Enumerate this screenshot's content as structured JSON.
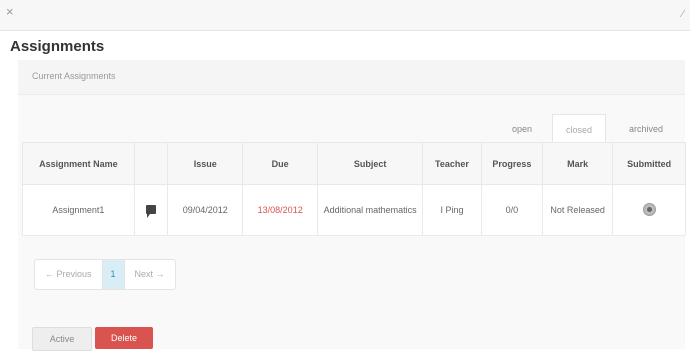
{
  "window": {
    "close_glyph": "×",
    "resize_glyph": "⁄"
  },
  "page": {
    "title": "Assignments"
  },
  "panel": {
    "heading": "Current Assignments"
  },
  "filters": {
    "open": "open",
    "closed": "closed",
    "archived": "archived"
  },
  "table": {
    "headers": {
      "name": "Assignment Name",
      "comment": "",
      "issue": "Issue",
      "due": "Due",
      "subject": "Subject",
      "teacher": "Teacher",
      "progress": "Progress",
      "mark": "Mark",
      "submitted": "Submitted"
    },
    "rows": [
      {
        "name": "Assignment1",
        "issue": "09/04/2012",
        "due": "13/08/2012",
        "subject": "Additional mathematics",
        "teacher": "I Ping",
        "progress": "0/0",
        "mark": "Not Released"
      }
    ]
  },
  "pagination": {
    "prev": "← Previous",
    "current": "1",
    "next": "Next →"
  },
  "actions": {
    "active_label": "Active",
    "delete_label": "Delete"
  },
  "colors": {
    "due_date": "#d9534f",
    "delete_button": "#d9534f",
    "current_page_bg": "#d9edf7"
  }
}
